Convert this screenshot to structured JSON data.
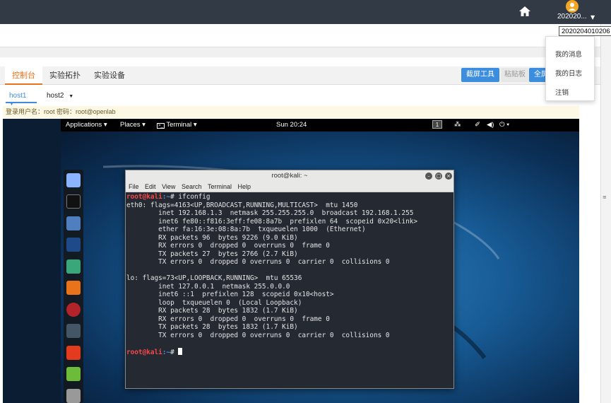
{
  "topbar": {
    "home_icon": "home-icon",
    "user_name": "202020...",
    "user_tooltip": "2020204010206"
  },
  "user_menu": {
    "items": [
      "我的消息",
      "我的日志",
      "注销"
    ]
  },
  "tabs": [
    {
      "label": "控制台",
      "active": true
    },
    {
      "label": "实验拓扑",
      "active": false
    },
    {
      "label": "实验设备",
      "active": false
    }
  ],
  "actions": {
    "screenshot": "截屏工具",
    "paste": "粘贴板",
    "fullscreen": "全屏"
  },
  "hosts": [
    {
      "label": "host1",
      "active": true
    },
    {
      "label": "host2",
      "active": false
    }
  ],
  "login_info": "登录用户名：root 密码：root@openlab",
  "vm": {
    "menu": {
      "applications": "Applications",
      "places": "Places",
      "terminal": "Terminal",
      "clock": "Sun 20:24",
      "workspace": "1"
    },
    "terminal": {
      "title": "root@kali: ~",
      "menu": [
        "File",
        "Edit",
        "View",
        "Search",
        "Terminal",
        "Help"
      ],
      "prompt_user": "root@kali",
      "prompt_path": ":~",
      "prompt_symbol": "# ",
      "command": "ifconfig",
      "output": [
        "eth0: flags=4163<UP,BROADCAST,RUNNING,MULTICAST>  mtu 1450",
        "        inet 192.168.1.3  netmask 255.255.255.0  broadcast 192.168.1.255",
        "        inet6 fe80::f816:3eff:fe08:8a7b  prefixlen 64  scopeid 0x20<link>",
        "        ether fa:16:3e:08:8a:7b  txqueuelen 1000  (Ethernet)",
        "        RX packets 96  bytes 9226 (9.0 KiB)",
        "        RX errors 0  dropped 0  overruns 0  frame 0",
        "        TX packets 27  bytes 2766 (2.7 KiB)",
        "        TX errors 0  dropped 0 overruns 0  carrier 0  collisions 0",
        "",
        "lo: flags=73<UP,LOOPBACK,RUNNING>  mtu 65536",
        "        inet 127.0.0.1  netmask 255.0.0.0",
        "        inet6 ::1  prefixlen 128  scopeid 0x10<host>",
        "        loop  txqueuelen 0  (Local Loopback)",
        "        RX packets 28  bytes 1832 (1.7 KiB)",
        "        RX errors 0  dropped 0  overruns 0  frame 0",
        "        TX packets 28  bytes 1832 (1.7 KiB)",
        "        TX errors 0  dropped 0 overruns 0  carrier 0  collisions 0",
        ""
      ]
    },
    "dock_icons": [
      "app-icon",
      "terminal-icon",
      "files-icon",
      "metasploit-icon",
      "armitage-icon",
      "burpsuite-icon",
      "beef-icon",
      "kismet-icon",
      "faraday-icon",
      "notes-icon",
      "more-icon"
    ]
  },
  "colors": {
    "topbar": "#323a45",
    "accent_orange": "#e8731a",
    "button_blue": "#3c8dde",
    "prompt_red": "#f5484b",
    "path_blue": "#4f8ed6"
  }
}
